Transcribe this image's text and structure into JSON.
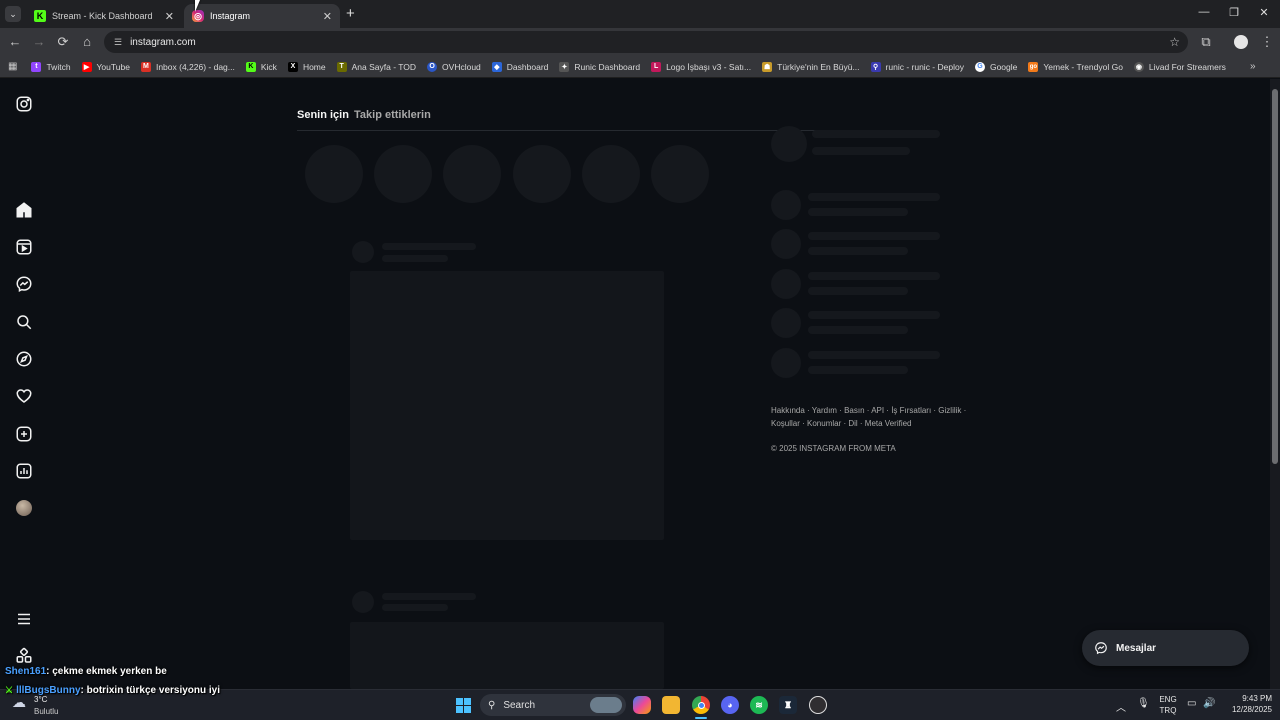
{
  "browser": {
    "tabs": [
      {
        "title": "Stream - Kick Dashboard",
        "active": false,
        "icon": "kick-icon"
      },
      {
        "title": "Instagram",
        "active": true,
        "icon": "instagram-icon"
      }
    ],
    "url": "instagram.com",
    "bookmarks": [
      {
        "label": "Twitch",
        "color": "#9146ff",
        "glyph": "t"
      },
      {
        "label": "YouTube",
        "color": "#ff0000",
        "glyph": "▶"
      },
      {
        "label": "Inbox (4,226) - dag...",
        "color": "#d93025",
        "glyph": "M"
      },
      {
        "label": "Kick",
        "color": "#53fc18",
        "glyph": "K"
      },
      {
        "label": "Home",
        "color": "#000000",
        "glyph": "X"
      },
      {
        "label": "Ana Sayfa - TOD",
        "color": "#6a6a00",
        "glyph": "T"
      },
      {
        "label": "OVHcloud",
        "color": "#2a56c6",
        "glyph": "O"
      },
      {
        "label": "Dashboard",
        "color": "#2b66d9",
        "glyph": "◆"
      },
      {
        "label": "Runic Dashboard",
        "color": "#777777",
        "glyph": "✦"
      },
      {
        "label": "Logo İşbaşı v3 - Satı...",
        "color": "#c2185b",
        "glyph": "L"
      },
      {
        "label": "Türkiye'nin En Büyü...",
        "color": "#c89b2a",
        "glyph": "☗"
      },
      {
        "label": "runic - runic - Deploy",
        "color": "#3a3ab0",
        "glyph": "⚲"
      },
      {
        "label": "Google",
        "color": "#4285f4",
        "glyph": "G"
      },
      {
        "label": "Yemek - Trendyol Go",
        "color": "#f27a1a",
        "glyph": "go"
      },
      {
        "label": "Livad For Streamers",
        "color": "#555555",
        "glyph": "◉"
      }
    ]
  },
  "instagram": {
    "feed_tabs": {
      "for_you": "Senin için",
      "following": "Takip ettiklerin"
    },
    "footer": {
      "links_line1": "Hakkında · Yardım · Basın · API · İş Fırsatları · Gizlilik ·",
      "links_line2": "Koşullar · Konumlar · Dil · Meta Verified",
      "copyright": "© 2025 INSTAGRAM FROM META"
    },
    "messages_label": "Mesajlar"
  },
  "chat_overlay": [
    {
      "user": "Shen161",
      "message": ": çekme ekmek yerken be"
    },
    {
      "user": "lllBugsBunny",
      "message": ": botrixin türkçe versiyonu iyi"
    }
  ],
  "taskbar": {
    "weather_temp": "3°C",
    "weather_desc": "Bulutlu",
    "search_label": "Search",
    "lang_top": "ENG",
    "lang_bottom": "TRQ",
    "time": "9:43 PM",
    "date": "12/28/2025"
  }
}
